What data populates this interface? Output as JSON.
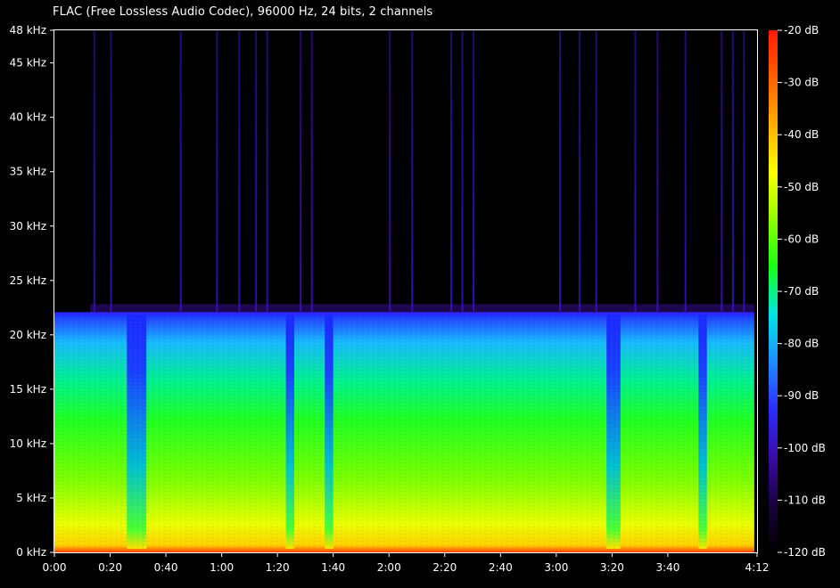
{
  "window": {
    "title": "FLAC (Free Lossless Audio Codec), 96000 Hz, 24 bits, 2 channels"
  },
  "colors": {
    "background": "#000000",
    "axis": "#ffffff",
    "scale_stops": [
      "#000000",
      "#1a0040",
      "#3b0aa6",
      "#2a2cff",
      "#1f8cff",
      "#00e6e6",
      "#15ff15",
      "#8dff00",
      "#ffff00",
      "#ffb000",
      "#ff6000",
      "#ff1a00"
    ]
  },
  "chart_data": {
    "type": "heatmap",
    "title": "FLAC (Free Lossless Audio Codec), 96000 Hz, 24 bits, 2 channels",
    "xlabel": "",
    "ylabel": "",
    "x_unit": "time (m:ss)",
    "y_unit": "kHz",
    "xlim": [
      0,
      252
    ],
    "ylim": [
      0,
      48
    ],
    "x_ticks": [
      "0:00",
      "0:20",
      "0:40",
      "1:00",
      "1:20",
      "1:40",
      "2:00",
      "2:20",
      "2:40",
      "3:00",
      "3:20",
      "3:40",
      "4:12"
    ],
    "x_tick_seconds": [
      0,
      20,
      40,
      60,
      80,
      100,
      120,
      140,
      160,
      180,
      200,
      220,
      252
    ],
    "y_ticks": [
      "0 kHz",
      "5 kHz",
      "10 kHz",
      "15 kHz",
      "20 kHz",
      "25 kHz",
      "30 kHz",
      "35 kHz",
      "40 kHz",
      "45 kHz",
      "48 kHz"
    ],
    "y_tick_values": [
      0,
      5,
      10,
      15,
      20,
      25,
      30,
      35,
      40,
      45,
      48
    ],
    "colorbar_labels": [
      "-20 dB",
      "-30 dB",
      "-40 dB",
      "-50 dB",
      "-60 dB",
      "-70 dB",
      "-80 dB",
      "-90 dB",
      "-100 dB",
      "-110 dB",
      "-120 dB"
    ],
    "colorbar_values": [
      -20,
      -30,
      -40,
      -50,
      -60,
      -70,
      -80,
      -90,
      -100,
      -110,
      -120
    ],
    "colorbar_range": [
      -120,
      -20
    ],
    "content_cutoff_khz": 22,
    "audio_end_seconds": 251,
    "quiet_segments_seconds": [
      [
        26,
        33
      ],
      [
        83,
        86
      ],
      [
        97,
        100
      ],
      [
        198,
        203
      ],
      [
        231,
        234
      ]
    ],
    "spike_times_seconds": [
      14,
      20,
      45,
      58,
      66,
      72,
      76,
      88,
      92,
      120,
      128,
      142,
      146,
      150,
      181,
      188,
      194,
      208,
      216,
      226,
      239,
      243,
      247
    ],
    "grid": false,
    "legend": "colorbar right"
  }
}
